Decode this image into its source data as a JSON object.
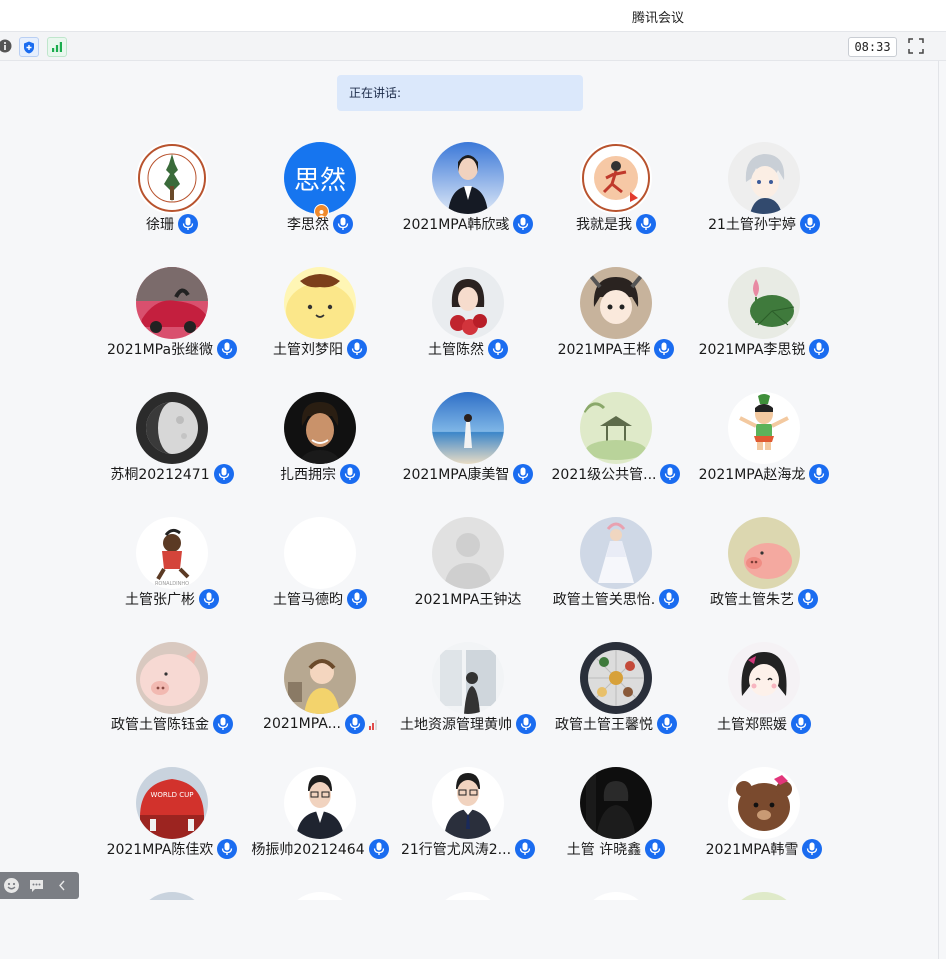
{
  "window": {
    "title": "腾讯会议"
  },
  "toolbar": {
    "time": "08:33"
  },
  "speaking": {
    "label": "正在讲话:"
  },
  "colors": {
    "accent": "#1a6cf0",
    "speaking_bg": "#dbe8fb",
    "placeholder_avatar": "#1675ef"
  },
  "participants": [
    {
      "name": "徐珊",
      "avatar": "hlj-university-seal",
      "mic": true
    },
    {
      "name": "李思然",
      "avatar": "text",
      "avatar_text": "思然",
      "mic": true,
      "host_badge": true
    },
    {
      "name": "2021MPA韩欣彧",
      "avatar": "photo-woman-suit",
      "mic": true
    },
    {
      "name": "我就是我",
      "avatar": "hlj-university-seal-runner",
      "mic": true
    },
    {
      "name": "21土管孙宇婷",
      "avatar": "anime-silver-hair",
      "mic": true
    },
    {
      "name": "2021MPa张继微",
      "avatar": "photo-red-car",
      "mic": true
    },
    {
      "name": "土管刘梦阳",
      "avatar": "cartoon-pompompurin",
      "mic": true
    },
    {
      "name": "土管陈然",
      "avatar": "photo-girl-roses",
      "mic": true
    },
    {
      "name": "2021MPA王桦",
      "avatar": "cartoon-girl",
      "mic": true
    },
    {
      "name": "2021MPA李思锐",
      "avatar": "photo-lotus-leaf",
      "mic": true
    },
    {
      "name": "苏桐20212471",
      "avatar": "photo-moon",
      "mic": true
    },
    {
      "name": "扎西拥宗",
      "avatar": "photo-man-dark",
      "mic": true
    },
    {
      "name": "2021MPA康美智",
      "avatar": "photo-beach",
      "mic": true
    },
    {
      "name": "2021级公共管...",
      "avatar": "painting-pavilion",
      "mic": true
    },
    {
      "name": "2021MPA赵海龙",
      "avatar": "cartoon-calabash-boy",
      "mic": true
    },
    {
      "name": "土管张广彬",
      "avatar": "cartoon-ronaldinho",
      "mic": true
    },
    {
      "name": "土管马德昀",
      "avatar": "blank-white",
      "mic": true
    },
    {
      "name": "2021MPA王钟达",
      "avatar": "default-silhouette",
      "mic": false
    },
    {
      "name": "政管土管关思怡.",
      "avatar": "painting-girl-dress",
      "mic": true
    },
    {
      "name": "政管土管朱艺",
      "avatar": "photo-pig-pink",
      "mic": true
    },
    {
      "name": "政管土管陈钰金",
      "avatar": "photo-piglet",
      "mic": true
    },
    {
      "name": "2021MPA...",
      "avatar": "photo-baby",
      "mic": true,
      "signal": true
    },
    {
      "name": "土地资源管理黄帅",
      "avatar": "photo-window-silhouette",
      "mic": true
    },
    {
      "name": "政管土管王馨悦",
      "avatar": "photo-food-plate",
      "mic": true
    },
    {
      "name": "土管郑熙媛",
      "avatar": "cartoon-girl-black-hair",
      "mic": true
    },
    {
      "name": "2021MPA陈佳欢",
      "avatar": "photo-world-cup-stadium",
      "mic": true
    },
    {
      "name": "杨振帅20212464",
      "avatar": "photo-man-glasses",
      "mic": true
    },
    {
      "name": "21行管尤风涛2...",
      "avatar": "photo-man-tie",
      "mic": true
    },
    {
      "name": "土管 许晓鑫",
      "avatar": "photo-dark-figure",
      "mic": true
    },
    {
      "name": "2021MPA韩雪",
      "avatar": "cartoon-brown-bear",
      "mic": true
    }
  ]
}
